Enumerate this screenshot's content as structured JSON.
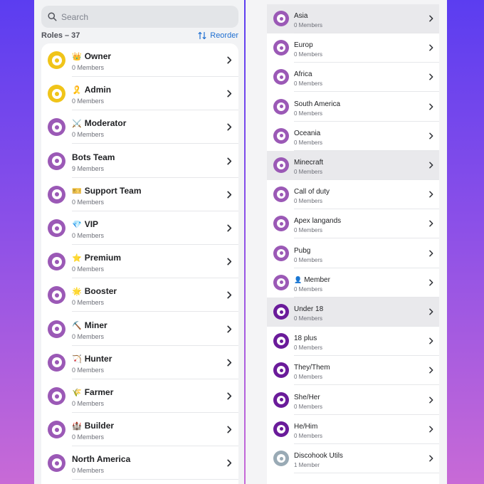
{
  "search": {
    "placeholder": "Search"
  },
  "roles_header": {
    "count_label": "Roles – 37",
    "reorder_label": "Reorder"
  },
  "colors": {
    "gold": "#f0c419",
    "purple": "#9b59b6",
    "dark_purple": "#6a1b9a",
    "gray": "#99aab5",
    "accent_blue": "#1f6fd1"
  },
  "left_roles": [
    {
      "emoji": "👑",
      "name": "Owner",
      "members": "0 Members",
      "color": "#f0c419"
    },
    {
      "emoji": "🎗️",
      "name": "Admin",
      "members": "0 Members",
      "color": "#f0c419"
    },
    {
      "emoji": "⚔️",
      "name": "Moderator",
      "members": "0 Members",
      "color": "#9b59b6"
    },
    {
      "emoji": "",
      "name": "Bots Team",
      "members": "9 Members",
      "color": "#9b59b6"
    },
    {
      "emoji": "🎫",
      "name": "Support Team",
      "members": "0 Members",
      "color": "#9b59b6"
    },
    {
      "emoji": "💎",
      "name": "VIP",
      "members": "0 Members",
      "color": "#9b59b6"
    },
    {
      "emoji": "⭐",
      "name": "Premium",
      "members": "0 Members",
      "color": "#9b59b6"
    },
    {
      "emoji": "🌟",
      "name": "Booster",
      "members": "0 Members",
      "color": "#9b59b6"
    },
    {
      "emoji": "⛏️",
      "name": "Miner",
      "members": "0 Members",
      "color": "#9b59b6"
    },
    {
      "emoji": "🏹",
      "name": "Hunter",
      "members": "0 Members",
      "color": "#9b59b6"
    },
    {
      "emoji": "🌾",
      "name": "Farmer",
      "members": "0 Members",
      "color": "#9b59b6"
    },
    {
      "emoji": "🏰",
      "name": "Builder",
      "members": "0 Members",
      "color": "#9b59b6"
    },
    {
      "emoji": "",
      "name": "North America",
      "members": "0 Members",
      "color": "#9b59b6"
    }
  ],
  "right_roles": [
    {
      "emoji": "",
      "name": "Asia",
      "members": "0 Members",
      "color": "#9b59b6",
      "highlight": true
    },
    {
      "emoji": "",
      "name": "Europ",
      "members": "0 Members",
      "color": "#9b59b6",
      "highlight": false
    },
    {
      "emoji": "",
      "name": "Africa",
      "members": "0 Members",
      "color": "#9b59b6",
      "highlight": false
    },
    {
      "emoji": "",
      "name": "South America",
      "members": "0 Members",
      "color": "#9b59b6",
      "highlight": false
    },
    {
      "emoji": "",
      "name": "Oceania",
      "members": "0 Members",
      "color": "#9b59b6",
      "highlight": false
    },
    {
      "emoji": "",
      "name": "Minecraft",
      "members": "0 Members",
      "color": "#9b59b6",
      "highlight": true
    },
    {
      "emoji": "",
      "name": "Call of duty",
      "members": "0 Members",
      "color": "#9b59b6",
      "highlight": false
    },
    {
      "emoji": "",
      "name": "Apex langands",
      "members": "0 Members",
      "color": "#9b59b6",
      "highlight": false
    },
    {
      "emoji": "",
      "name": "Pubg",
      "members": "0 Members",
      "color": "#9b59b6",
      "highlight": false
    },
    {
      "emoji": "👤",
      "name": "Member",
      "members": "0 Members",
      "color": "#9b59b6",
      "highlight": false
    },
    {
      "emoji": "",
      "name": "Under 18",
      "members": "0 Members",
      "color": "#6a1b9a",
      "highlight": true
    },
    {
      "emoji": "",
      "name": "18 plus",
      "members": "0 Members",
      "color": "#6a1b9a",
      "highlight": false
    },
    {
      "emoji": "",
      "name": "They/Them",
      "members": "0 Members",
      "color": "#6a1b9a",
      "highlight": false
    },
    {
      "emoji": "",
      "name": "She/Her",
      "members": "0 Members",
      "color": "#6a1b9a",
      "highlight": false
    },
    {
      "emoji": "",
      "name": "He/Him",
      "members": "0 Members",
      "color": "#6a1b9a",
      "highlight": false
    },
    {
      "emoji": "",
      "name": "Discohook Utils",
      "members": "1 Member",
      "color": "#99aab5",
      "highlight": false
    }
  ]
}
